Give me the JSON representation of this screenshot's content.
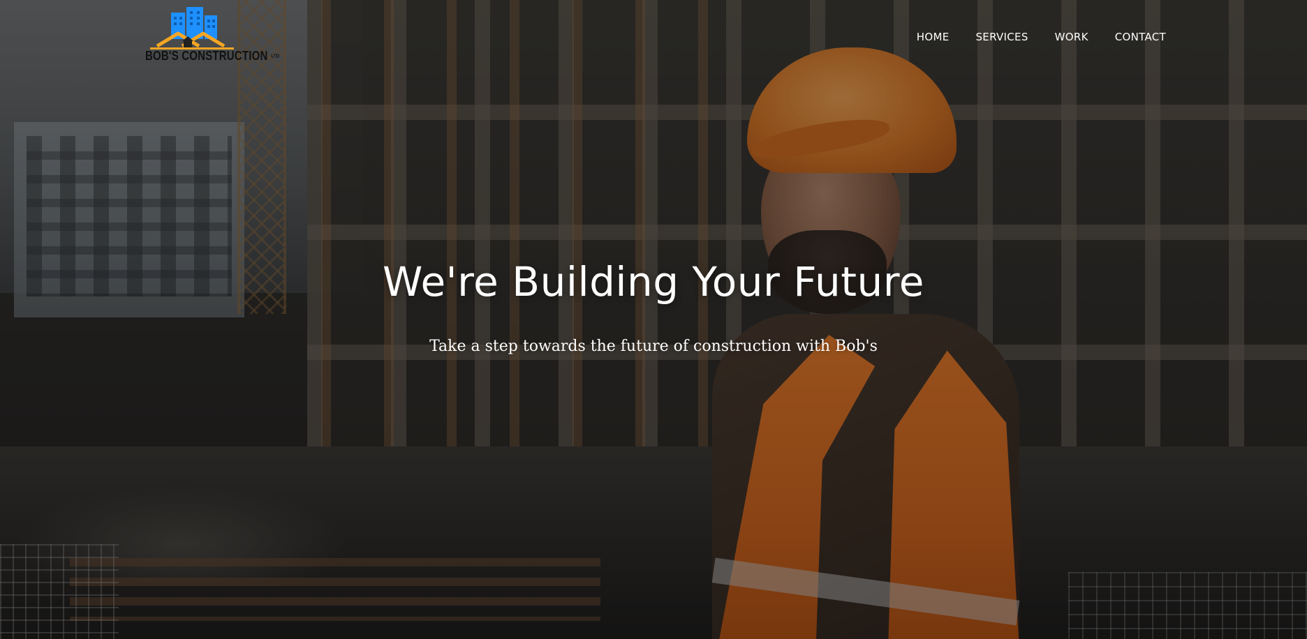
{
  "brand": {
    "name": "BOB'S CONSTRUCTION",
    "suffix": "LTD",
    "colors": {
      "logo_blue": "#1e90ff",
      "logo_orange": "#f5a623",
      "logo_text": "#111111"
    }
  },
  "nav": {
    "items": [
      {
        "label": "HOME"
      },
      {
        "label": "SERVICES"
      },
      {
        "label": "WORK"
      },
      {
        "label": "CONTACT"
      }
    ]
  },
  "hero": {
    "title": "We're Building Your Future",
    "subtitle": "Take a step towards the future of construction with Bob's",
    "text_color": "#ffffff"
  }
}
